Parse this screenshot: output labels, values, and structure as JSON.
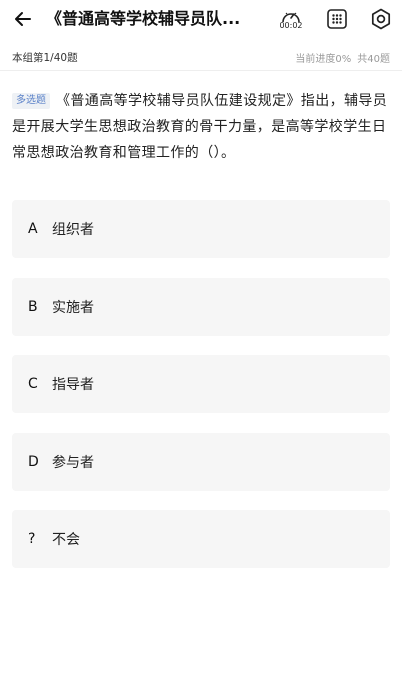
{
  "header": {
    "title": "《普通高等学校辅导员队...",
    "timer": "00:02"
  },
  "subbar": {
    "group": "本组第1/40题",
    "progress": "当前进度0%",
    "total": "共40题"
  },
  "question": {
    "type": "多选题",
    "text": "《普通高等学校辅导员队伍建设规定》指出，辅导员是开展大学生思想政治教育的骨干力量，是高等学校学生日常思想政治教育和管理工作的（）。"
  },
  "options": [
    {
      "letter": "A",
      "text": "组织者"
    },
    {
      "letter": "B",
      "text": "实施者"
    },
    {
      "letter": "C",
      "text": "指导者"
    },
    {
      "letter": "D",
      "text": "参与者"
    },
    {
      "letter": "?",
      "text": "不会"
    }
  ],
  "icons": {
    "back": "back-arrow-icon",
    "timer": "timer-icon",
    "grid": "answer-card-icon",
    "settings": "settings-icon"
  }
}
